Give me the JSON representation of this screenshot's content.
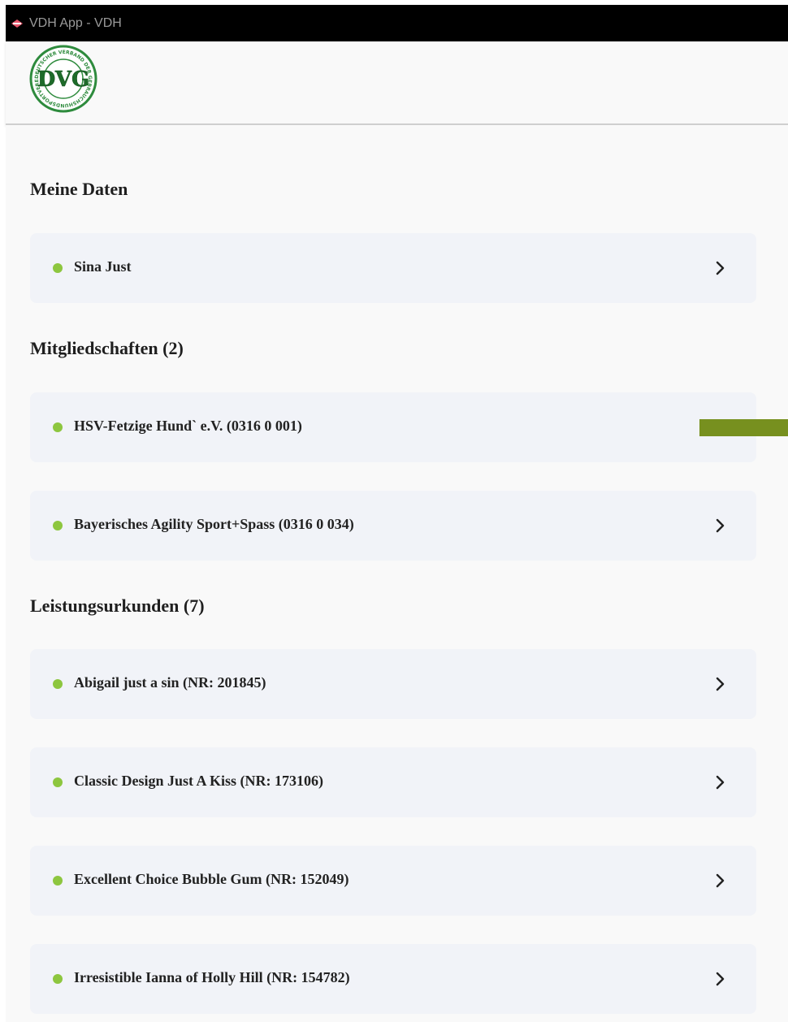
{
  "window": {
    "title": "VDH App - VDH",
    "app_icon": "vdh-app-icon"
  },
  "header": {
    "logo": {
      "name": "dvg-logo",
      "monogram": "DVG",
      "ring_text": "DEUTSCHER VERBAND DER GEBRAUCHSHUNDSPORTVEREINE",
      "colors": {
        "ring": "#2e8b3d",
        "monogram": "#1e6b2a",
        "background": "#ffffff"
      }
    }
  },
  "colors": {
    "status_dot": "#8dc63f",
    "card_background": "#f1f3f8",
    "page_background": "#f9f9f9",
    "side_marker": "#77901f",
    "titlebar": "#000000"
  },
  "sections": [
    {
      "title": "Meine Daten",
      "items": [
        {
          "label": "Sina Just",
          "status": "green",
          "chevron": true
        }
      ]
    },
    {
      "title": "Mitgliedschaften (2)",
      "items": [
        {
          "label": "HSV-Fetzige Hund` e.V. (0316 0 001)",
          "status": "green",
          "chevron": false
        },
        {
          "label": "Bayerisches Agility Sport+Spass (0316 0 034)",
          "status": "green",
          "chevron": true
        }
      ]
    },
    {
      "title": "Leistungsurkunden (7)",
      "items": [
        {
          "label": "Abigail just a sin (NR: 201845)",
          "status": "green",
          "chevron": true
        },
        {
          "label": "Classic Design Just A Kiss (NR: 173106)",
          "status": "green",
          "chevron": true
        },
        {
          "label": "Excellent Choice Bubble Gum (NR: 152049)",
          "status": "green",
          "chevron": true
        },
        {
          "label": "Irresistible Ianna of Holly Hill (NR: 154782)",
          "status": "green",
          "chevron": true
        }
      ]
    }
  ]
}
